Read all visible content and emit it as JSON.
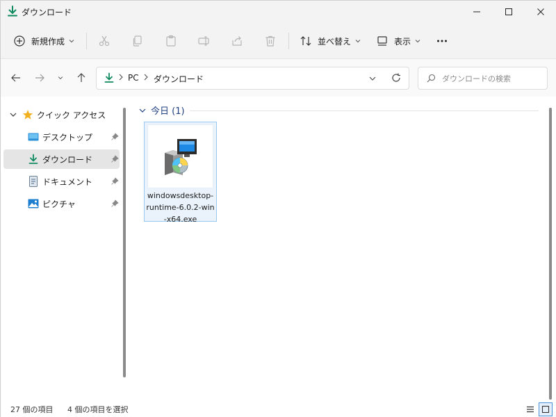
{
  "window": {
    "title": "ダウンロード",
    "minimize_icon": "minimize-icon",
    "maximize_icon": "maximize-icon",
    "close_icon": "close-icon"
  },
  "toolbar": {
    "new_label": "新規作成",
    "sort_label": "並べ替え",
    "view_label": "表示",
    "icons": [
      "cut-icon",
      "copy-icon",
      "paste-icon",
      "rename-icon",
      "share-icon",
      "delete-icon",
      "more-icon"
    ]
  },
  "address": {
    "crumbs": [
      "PC",
      "ダウンロード"
    ],
    "search_placeholder": "ダウンロードの検索"
  },
  "sidebar": {
    "quick_access": "クイック アクセス",
    "items": [
      {
        "label": "デスクトップ",
        "icon": "desktop-icon",
        "pinned": true
      },
      {
        "label": "ダウンロード",
        "icon": "download-icon",
        "pinned": true,
        "selected": true
      },
      {
        "label": "ドキュメント",
        "icon": "document-icon",
        "pinned": true
      },
      {
        "label": "ピクチャ",
        "icon": "pictures-icon",
        "pinned": true
      }
    ]
  },
  "content": {
    "group_label": "今日 (1)",
    "files": [
      {
        "name": "windowsdesktop-runtime-6.0.2-win-x64.exe",
        "icon": "installer-icon",
        "selected": true
      }
    ]
  },
  "status": {
    "item_count": "27 個の項目",
    "selected_count": "4 個の項目を選択"
  },
  "colors": {
    "accent": "#0f8a5f",
    "selection_border": "#99c8ef",
    "selection_fill": "#eaf3fc",
    "group_header": "#1f3f7f"
  }
}
